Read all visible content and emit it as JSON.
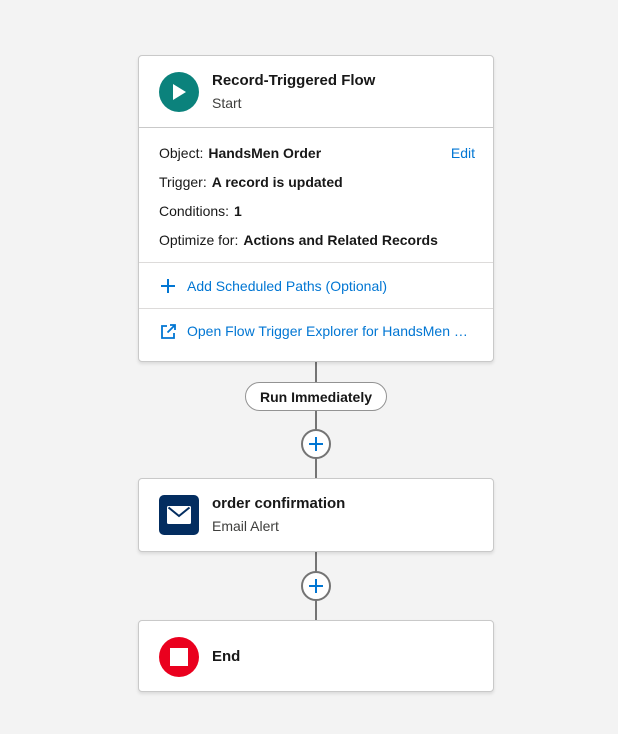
{
  "start_node": {
    "title": "Record-Triggered Flow",
    "subtitle": "Start",
    "icon": "play-icon",
    "object_label": "Object:",
    "object_value": "HandsMen Order",
    "edit_label": "Edit",
    "trigger_label": "Trigger:",
    "trigger_value": "A record is updated",
    "conditions_label": "Conditions:",
    "conditions_value": "1",
    "optimize_label": "Optimize for:",
    "optimize_value": "Actions and Related Records",
    "scheduled_paths_label": "Add Scheduled Paths (Optional)",
    "explorer_label": "Open Flow Trigger Explorer for HandsMen Order"
  },
  "path_label": "Run Immediately",
  "email_node": {
    "title": "order confirmation",
    "subtitle": "Email Alert",
    "icon": "envelope-icon"
  },
  "end_node": {
    "title": "End",
    "icon": "stop-icon"
  },
  "colors": {
    "start_icon": "#0b827c",
    "email_icon": "#032d60",
    "end_icon": "#ea001e",
    "link": "#0176d3",
    "canvas": "#f3f3f3"
  }
}
